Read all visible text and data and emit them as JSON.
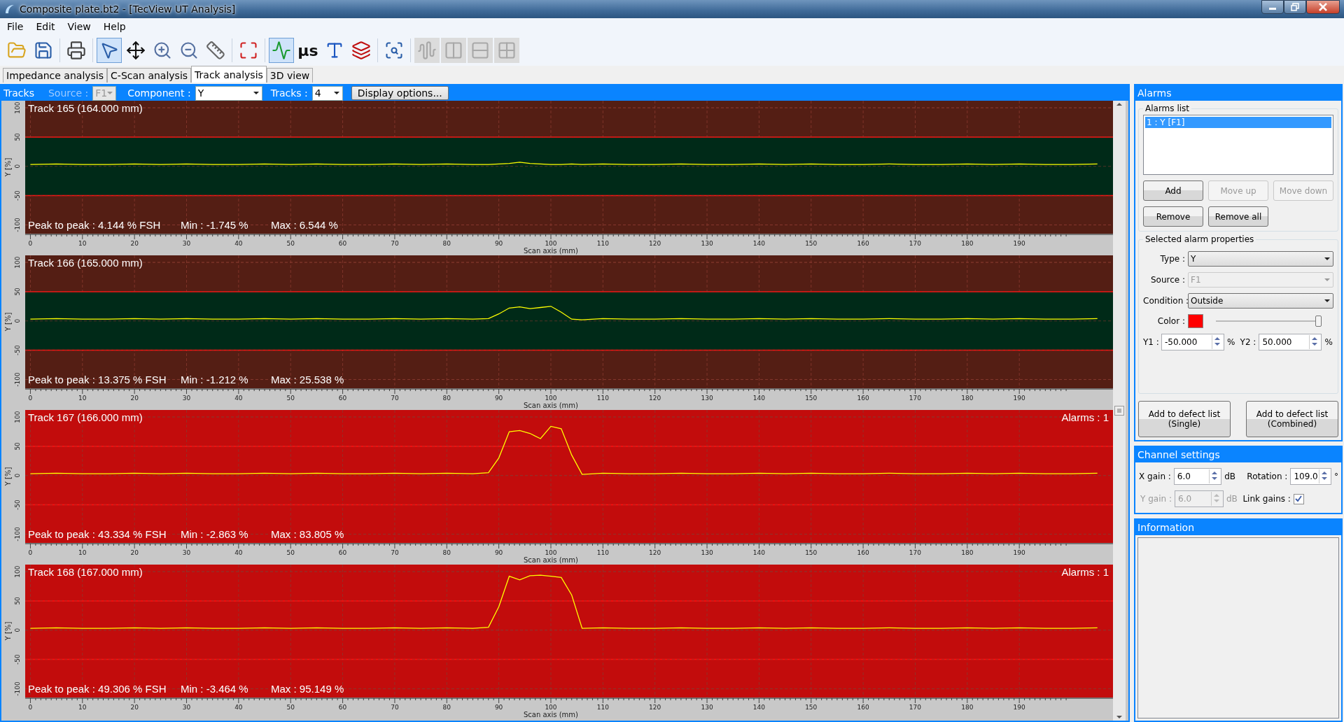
{
  "window": {
    "title": "Composite plate.bt2 - [TecView UT Analysis]"
  },
  "menu": [
    "File",
    "Edit",
    "View",
    "Help"
  ],
  "toolbar": [
    {
      "kind": "button",
      "selected": false,
      "disabled": false
    },
    {
      "kind": "button",
      "selected": false,
      "disabled": false
    },
    {
      "kind": "separator"
    },
    {
      "kind": "button",
      "selected": false,
      "disabled": false
    },
    {
      "kind": "separator"
    },
    {
      "kind": "button",
      "selected": true,
      "disabled": false
    },
    {
      "kind": "button",
      "selected": false,
      "disabled": false
    },
    {
      "kind": "button",
      "selected": false,
      "disabled": false
    },
    {
      "kind": "button",
      "selected": false,
      "disabled": false
    },
    {
      "kind": "button",
      "selected": false,
      "disabled": false
    },
    {
      "kind": "separator"
    },
    {
      "kind": "button",
      "selected": false,
      "disabled": false
    },
    {
      "kind": "separator"
    },
    {
      "kind": "button",
      "selected": true,
      "disabled": false
    },
    {
      "kind": "text",
      "text": "µs",
      "selected": false,
      "disabled": false
    },
    {
      "kind": "button",
      "selected": false,
      "disabled": false
    },
    {
      "kind": "button",
      "selected": false,
      "disabled": false
    },
    {
      "kind": "separator"
    },
    {
      "kind": "button",
      "selected": false,
      "disabled": false
    },
    {
      "kind": "separator"
    },
    {
      "kind": "button",
      "selected": false,
      "disabled": true
    },
    {
      "kind": "button",
      "selected": false,
      "disabled": true
    },
    {
      "kind": "button",
      "selected": false,
      "disabled": true
    },
    {
      "kind": "button",
      "selected": false,
      "disabled": true
    }
  ],
  "tabs": [
    {
      "label": "Impedance analysis",
      "selected": false
    },
    {
      "label": "C-Scan analysis",
      "selected": false
    },
    {
      "label": "Track analysis",
      "selected": true
    },
    {
      "label": "3D view",
      "selected": false
    }
  ],
  "tracks_bar": {
    "title": "Tracks",
    "source": {
      "label": "Source :",
      "value": "F1",
      "disabled": true
    },
    "component": {
      "label": "Component :",
      "value": "Y"
    },
    "tracks": {
      "label": "Tracks :",
      "value": "4"
    },
    "button": "Display options..."
  },
  "tracks": [
    {
      "alarm": false,
      "stats": [
        "Peak to peak : 4.144 % FSH",
        "Min : -1.745 %",
        "Max : 6.544 %"
      ],
      "chart_data": {
        "type": "line",
        "title": "Track 165 (164.000 mm)",
        "xlabel": "Scan axis (mm)",
        "ylabel": "Y [%]",
        "x": [
          0,
          5,
          10,
          15,
          20,
          25,
          30,
          35,
          40,
          45,
          50,
          55,
          60,
          65,
          70,
          75,
          80,
          85,
          88,
          90,
          92,
          94,
          96,
          98,
          100,
          102,
          104,
          106,
          110,
          115,
          120,
          125,
          130,
          135,
          140,
          145,
          150,
          155,
          160,
          165,
          170,
          175,
          180,
          185,
          190,
          195,
          200,
          205
        ],
        "series": [
          {
            "color": "#ffff00",
            "values": [
              3,
              4,
              3,
              3,
              4,
              3,
              4,
              3,
              3,
              4,
              3,
              4,
              3,
              3,
              4,
              3,
              4,
              3,
              3,
              4,
              5,
              7,
              5,
              4,
              3,
              3,
              4,
              3,
              4,
              3,
              3,
              4,
              3,
              3,
              4,
              3,
              4,
              3,
              3,
              4,
              3,
              3,
              4,
              3,
              4,
              3,
              3,
              4
            ]
          }
        ],
        "grid": true,
        "xlim": [
          -1,
          208
        ],
        "ylim": [
          -115,
          112
        ],
        "xticks": [
          0,
          10,
          20,
          30,
          40,
          50,
          60,
          70,
          80,
          90,
          100,
          110,
          120,
          130,
          140,
          150,
          160,
          170,
          180,
          190
        ],
        "yticks": [
          -100,
          -50,
          0,
          50,
          100
        ]
      }
    },
    {
      "alarm": false,
      "stats": [
        "Peak to peak : 13.375 % FSH",
        "Min : -1.212 %",
        "Max : 25.538 %"
      ],
      "chart_data": {
        "type": "line",
        "title": "Track 166 (165.000 mm)",
        "xlabel": "Scan axis (mm)",
        "ylabel": "Y [%]",
        "x": [
          0,
          5,
          10,
          15,
          20,
          25,
          30,
          35,
          40,
          45,
          50,
          55,
          60,
          65,
          70,
          75,
          80,
          85,
          88,
          90,
          92,
          94,
          96,
          98,
          100,
          102,
          104,
          106,
          110,
          115,
          120,
          125,
          130,
          135,
          140,
          145,
          150,
          155,
          160,
          165,
          170,
          175,
          180,
          185,
          190,
          195,
          200,
          205
        ],
        "series": [
          {
            "color": "#ffff00",
            "values": [
              3,
              4,
              3,
              3,
              4,
              3,
              4,
              3,
              3,
              4,
              3,
              4,
              3,
              3,
              4,
              3,
              4,
              3,
              4,
              12,
              22,
              24,
              21,
              23,
              25,
              15,
              3,
              2,
              4,
              3,
              3,
              4,
              3,
              3,
              4,
              3,
              4,
              3,
              3,
              4,
              3,
              3,
              4,
              3,
              4,
              3,
              3,
              4
            ]
          }
        ],
        "grid": true,
        "xlim": [
          -1,
          208
        ],
        "ylim": [
          -115,
          112
        ],
        "xticks": [
          0,
          10,
          20,
          30,
          40,
          50,
          60,
          70,
          80,
          90,
          100,
          110,
          120,
          130,
          140,
          150,
          160,
          170,
          180,
          190
        ],
        "yticks": [
          -100,
          -50,
          0,
          50,
          100
        ]
      }
    },
    {
      "alarm": true,
      "alarms_label": "Alarms : 1",
      "stats": [
        "Peak to peak : 43.334 % FSH",
        "Min : -2.863 %",
        "Max : 83.805 %"
      ],
      "chart_data": {
        "type": "line",
        "title": "Track 167 (166.000 mm)",
        "xlabel": "Scan axis (mm)",
        "ylabel": "Y [%]",
        "x": [
          0,
          5,
          10,
          15,
          20,
          25,
          30,
          35,
          40,
          45,
          50,
          55,
          60,
          65,
          70,
          75,
          80,
          85,
          88,
          90,
          92,
          94,
          96,
          98,
          100,
          102,
          104,
          106,
          110,
          115,
          120,
          125,
          130,
          135,
          140,
          145,
          150,
          155,
          160,
          165,
          170,
          175,
          180,
          185,
          190,
          195,
          200,
          205
        ],
        "series": [
          {
            "color": "#ffff00",
            "values": [
              3,
              4,
              3,
              3,
              4,
              3,
              4,
              3,
              3,
              4,
              3,
              4,
              3,
              3,
              4,
              3,
              4,
              3,
              5,
              30,
              75,
              77,
              72,
              63,
              84,
              80,
              35,
              2,
              4,
              3,
              3,
              4,
              3,
              3,
              4,
              3,
              4,
              3,
              3,
              4,
              3,
              3,
              4,
              3,
              4,
              3,
              3,
              4
            ]
          }
        ],
        "grid": true,
        "xlim": [
          -1,
          208
        ],
        "ylim": [
          -115,
          112
        ],
        "xticks": [
          0,
          10,
          20,
          30,
          40,
          50,
          60,
          70,
          80,
          90,
          100,
          110,
          120,
          130,
          140,
          150,
          160,
          170,
          180,
          190
        ],
        "yticks": [
          -100,
          -50,
          0,
          50,
          100
        ]
      }
    },
    {
      "alarm": true,
      "alarms_label": "Alarms : 1",
      "stats": [
        "Peak to peak : 49.306 % FSH",
        "Min : -3.464 %",
        "Max : 95.149 %"
      ],
      "chart_data": {
        "type": "line",
        "title": "Track 168 (167.000 mm)",
        "xlabel": "Scan axis (mm)",
        "ylabel": "Y [%]",
        "x": [
          0,
          5,
          10,
          15,
          20,
          25,
          30,
          35,
          40,
          45,
          50,
          55,
          60,
          65,
          70,
          75,
          80,
          85,
          88,
          90,
          92,
          94,
          96,
          98,
          100,
          102,
          104,
          106,
          110,
          115,
          120,
          125,
          130,
          135,
          140,
          145,
          150,
          155,
          160,
          165,
          170,
          175,
          180,
          185,
          190,
          195,
          200,
          205
        ],
        "series": [
          {
            "color": "#ffff00",
            "values": [
              3,
              4,
              3,
              3,
              4,
              3,
              4,
              3,
              3,
              4,
              3,
              4,
              3,
              3,
              4,
              3,
              4,
              3,
              5,
              40,
              92,
              86,
              93,
              94,
              92,
              90,
              60,
              3,
              4,
              3,
              3,
              4,
              3,
              3,
              4,
              3,
              4,
              3,
              3,
              4,
              3,
              3,
              4,
              3,
              4,
              3,
              3,
              4
            ]
          }
        ],
        "grid": true,
        "xlim": [
          -1,
          208
        ],
        "ylim": [
          -115,
          112
        ],
        "xticks": [
          0,
          10,
          20,
          30,
          40,
          50,
          60,
          70,
          80,
          90,
          100,
          110,
          120,
          130,
          140,
          150,
          160,
          170,
          180,
          190
        ],
        "yticks": [
          -100,
          -50,
          0,
          50,
          100
        ]
      }
    }
  ],
  "alarms": {
    "title": "Alarms",
    "list_title": "Alarms list",
    "items": [
      {
        "label": "1 : Y [F1]",
        "selected": true
      }
    ],
    "buttons": [
      {
        "label": "Add",
        "disabled": false
      },
      {
        "label": "Move up",
        "disabled": true
      },
      {
        "label": "Move down",
        "disabled": true
      },
      {
        "label": "Remove",
        "disabled": false
      },
      {
        "label": "Remove all",
        "disabled": false
      }
    ],
    "props_title": "Selected alarm properties",
    "type": {
      "label": "Type :",
      "value": "Y",
      "disabled": false
    },
    "source": {
      "label": "Source :",
      "value": "F1",
      "disabled": true
    },
    "condition": {
      "label": "Condition :",
      "value": "Outside",
      "disabled": false
    },
    "color": {
      "label": "Color :",
      "color": "#ff0000"
    },
    "opacity": {
      "level": 1
    },
    "y1": {
      "label": "Y1 :",
      "value": "-50.000",
      "unit": "%"
    },
    "y2": {
      "label": "Y2 :",
      "value": "50.000",
      "unit": "%"
    },
    "defect_buttons": [
      "Add to defect list\n(Single)",
      "Add to defect list\n(Combined)"
    ]
  },
  "channel": {
    "title": "Channel settings",
    "x_gain": {
      "label": "X gain :",
      "value": "6.0",
      "unit": "dB"
    },
    "rotation": {
      "label": "Rotation :",
      "value": "109.0",
      "unit": "°"
    },
    "y_gain": {
      "label": "Y gain :",
      "value": "6.0",
      "unit": "dB",
      "disabled": true
    },
    "link": {
      "label": "Link gains :",
      "checked": true
    }
  },
  "information": {
    "title": "Information"
  }
}
